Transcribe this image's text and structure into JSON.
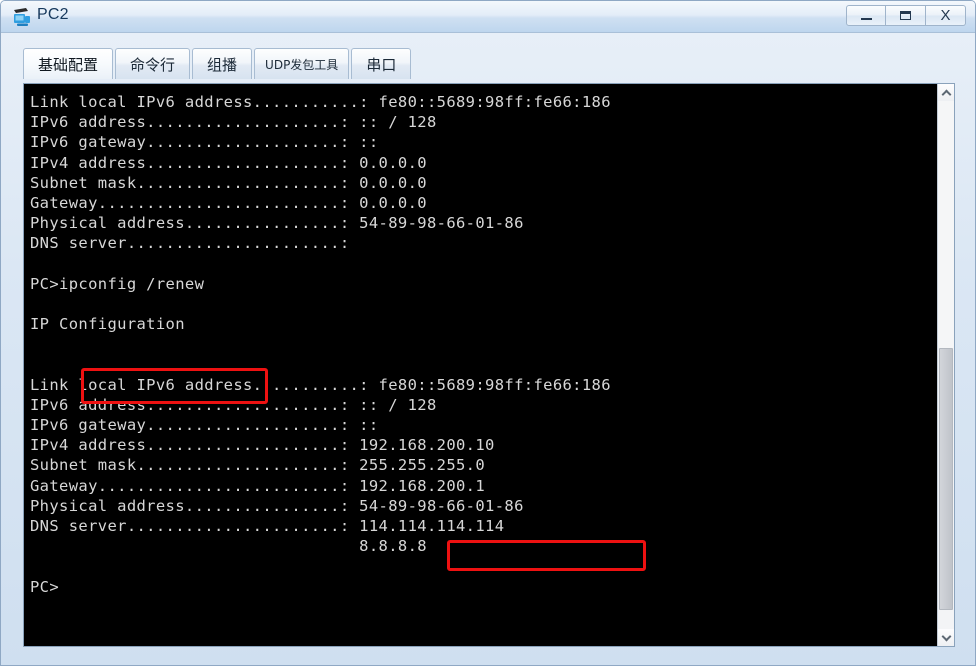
{
  "window": {
    "title": "PC2",
    "icon": "pc-device-icon",
    "controls": {
      "minimize": "–",
      "maximize": "▭",
      "close": "X"
    }
  },
  "tabs": [
    {
      "label": "基础配置",
      "active": true
    },
    {
      "label": "命令行",
      "active": false
    },
    {
      "label": "组播",
      "active": false
    },
    {
      "label": "UDP发包工具",
      "active": false
    },
    {
      "label": "串口",
      "active": false
    }
  ],
  "terminal": {
    "lines": [
      "Link local IPv6 address...........: fe80::5689:98ff:fe66:186",
      "IPv6 address....................: :: / 128",
      "IPv6 gateway....................: ::",
      "IPv4 address....................: 0.0.0.0",
      "Subnet mask.....................: 0.0.0.0",
      "Gateway.........................: 0.0.0.0",
      "Physical address................: 54-89-98-66-01-86",
      "DNS server......................:",
      "",
      "PC>ipconfig /renew",
      "",
      "IP Configuration",
      "",
      "",
      "Link local IPv6 address...........: fe80::5689:98ff:fe66:186",
      "IPv6 address....................: :: / 128",
      "IPv6 gateway....................: ::",
      "IPv4 address....................: 192.168.200.10",
      "Subnet mask.....................: 255.255.255.0",
      "Gateway.........................: 192.168.200.1",
      "Physical address................: 54-89-98-66-01-86",
      "DNS server......................: 114.114.114.114",
      "                                  8.8.8.8",
      "",
      "PC>"
    ],
    "prompt": "PC>",
    "command": "ipconfig /renew",
    "section_header": "IP Configuration",
    "before": {
      "link_local_ipv6": "fe80::5689:98ff:fe66:186",
      "ipv6_address": ":: / 128",
      "ipv6_gateway": "::",
      "ipv4_address": "0.0.0.0",
      "subnet_mask": "0.0.0.0",
      "gateway": "0.0.0.0",
      "physical_address": "54-89-98-66-01-86",
      "dns_server": ""
    },
    "after": {
      "link_local_ipv6": "fe80::5689:98ff:fe66:186",
      "ipv6_address": ":: / 128",
      "ipv6_gateway": "::",
      "ipv4_address": "192.168.200.10",
      "subnet_mask": "255.255.255.0",
      "gateway": "192.168.200.1",
      "physical_address": "54-89-98-66-01-86",
      "dns_server_primary": "114.114.114.114",
      "dns_server_secondary": "8.8.8.8"
    }
  },
  "highlights": [
    {
      "name": "command-highlight",
      "target": "ipconfig /renew",
      "color": "#ee1111"
    },
    {
      "name": "ipv4-address-highlight",
      "target": "192.168.200.10",
      "color": "#ee1111"
    }
  ],
  "scrollbar": {
    "up_arrow": "chevron-up-icon",
    "down_arrow": "chevron-down-icon"
  }
}
